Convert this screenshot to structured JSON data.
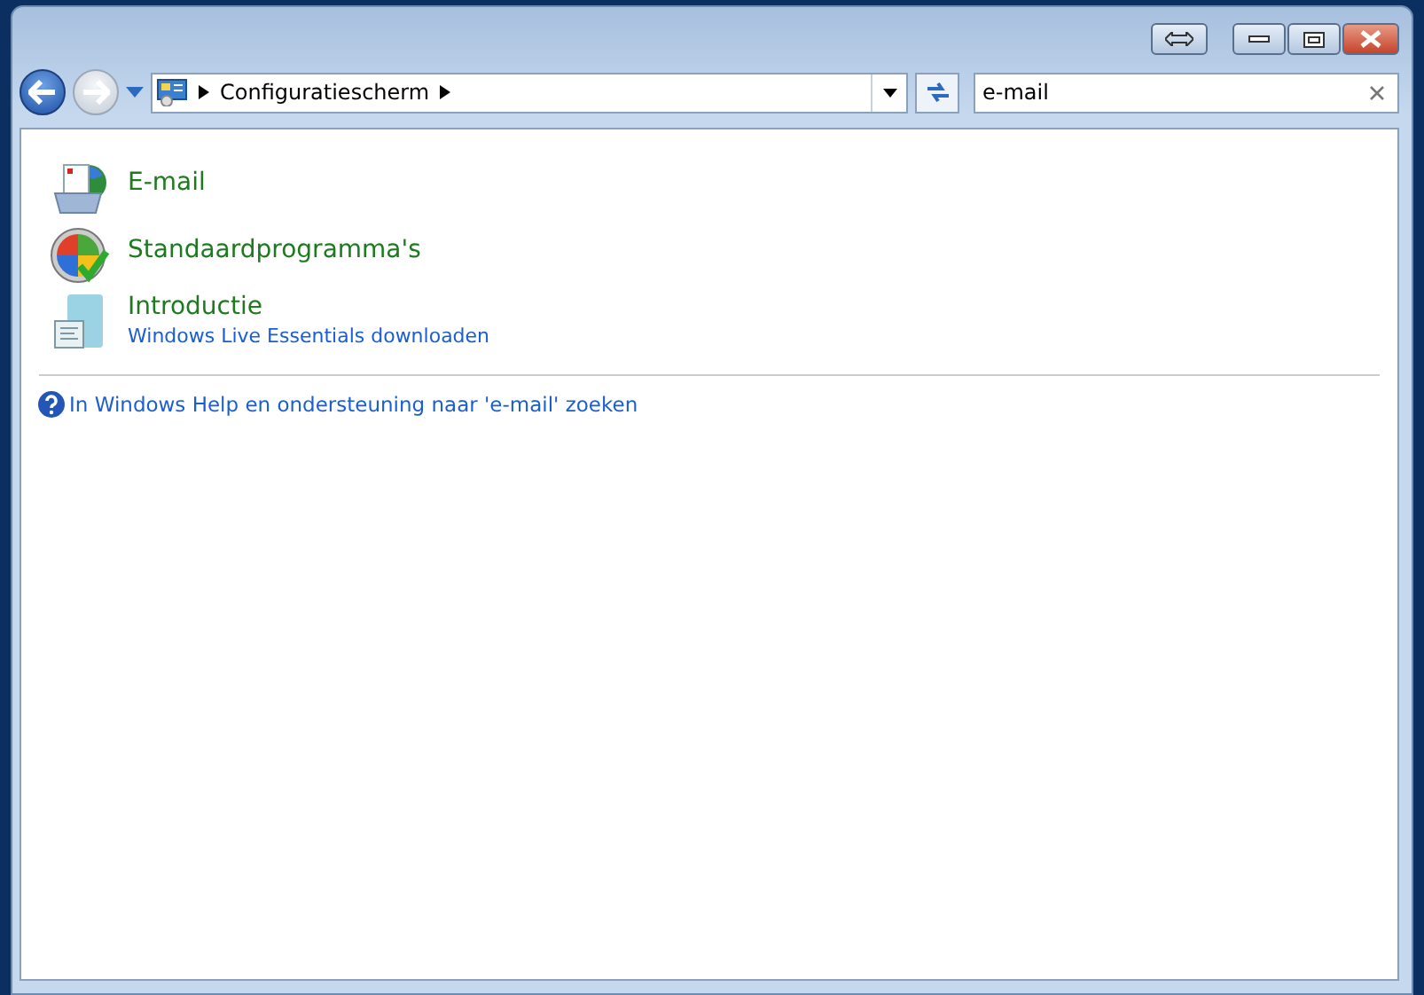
{
  "address_bar": {
    "breadcrumbs": [
      "Configuratiescherm"
    ]
  },
  "search": {
    "value": "e-mail"
  },
  "results": [
    {
      "title": "E-mail"
    },
    {
      "title": "Standaardprogramma's"
    },
    {
      "title": "Introductie",
      "link": "Windows Live Essentials downloaden"
    }
  ],
  "help_link": "In Windows Help en ondersteuning naar 'e-mail' zoeken"
}
